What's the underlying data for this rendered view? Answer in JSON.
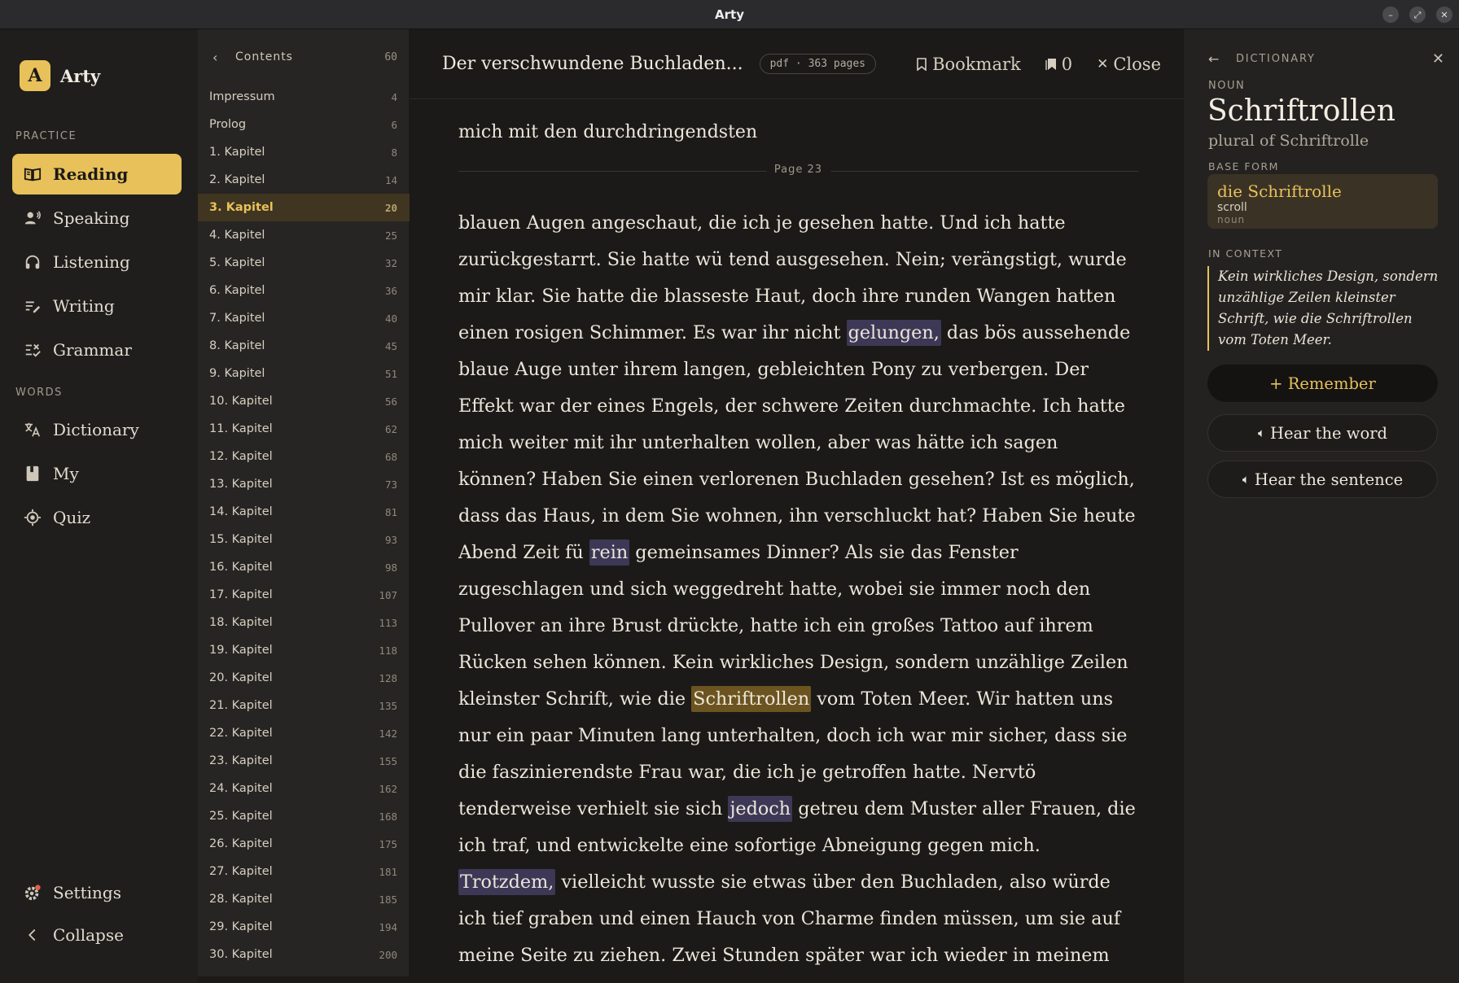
{
  "window": {
    "title": "Arty"
  },
  "brand": {
    "logo_letter": "A",
    "name": "Arty"
  },
  "sidebar": {
    "practice_label": "PRACTICE",
    "words_label": "WORDS",
    "practice_items": [
      {
        "label": "Reading",
        "icon": "book-icon",
        "active": true
      },
      {
        "label": "Speaking",
        "icon": "speaker-person-icon"
      },
      {
        "label": "Listening",
        "icon": "headphones-icon"
      },
      {
        "label": "Writing",
        "icon": "pen-lines-icon"
      },
      {
        "label": "Grammar",
        "icon": "checklist-icon"
      }
    ],
    "words_items": [
      {
        "label": "Dictionary",
        "icon": "translate-icon"
      },
      {
        "label": "My",
        "icon": "notebook-icon"
      },
      {
        "label": "Quiz",
        "icon": "target-icon"
      }
    ],
    "settings_label": "Settings",
    "collapse_label": "Collapse"
  },
  "toc": {
    "title": "Contents",
    "count": "60",
    "items": [
      {
        "title": "Impressum",
        "page": "4"
      },
      {
        "title": "Prolog",
        "page": "6"
      },
      {
        "title": "1. Kapitel",
        "page": "8"
      },
      {
        "title": "2. Kapitel",
        "page": "14"
      },
      {
        "title": "3. Kapitel",
        "page": "20",
        "active": true
      },
      {
        "title": "4. Kapitel",
        "page": "25"
      },
      {
        "title": "5. Kapitel",
        "page": "32"
      },
      {
        "title": "6. Kapitel",
        "page": "36"
      },
      {
        "title": "7. Kapitel",
        "page": "40"
      },
      {
        "title": "8. Kapitel",
        "page": "45"
      },
      {
        "title": "9. Kapitel",
        "page": "51"
      },
      {
        "title": "10. Kapitel",
        "page": "56"
      },
      {
        "title": "11. Kapitel",
        "page": "62"
      },
      {
        "title": "12. Kapitel",
        "page": "68"
      },
      {
        "title": "13. Kapitel",
        "page": "73"
      },
      {
        "title": "14. Kapitel",
        "page": "81"
      },
      {
        "title": "15. Kapitel",
        "page": "93"
      },
      {
        "title": "16. Kapitel",
        "page": "98"
      },
      {
        "title": "17. Kapitel",
        "page": "107"
      },
      {
        "title": "18. Kapitel",
        "page": "113"
      },
      {
        "title": "19. Kapitel",
        "page": "118"
      },
      {
        "title": "20. Kapitel",
        "page": "128"
      },
      {
        "title": "21. Kapitel",
        "page": "135"
      },
      {
        "title": "22. Kapitel",
        "page": "142"
      },
      {
        "title": "23. Kapitel",
        "page": "155"
      },
      {
        "title": "24. Kapitel",
        "page": "162"
      },
      {
        "title": "25. Kapitel",
        "page": "168"
      },
      {
        "title": "26. Kapitel",
        "page": "175"
      },
      {
        "title": "27. Kapitel",
        "page": "181"
      },
      {
        "title": "28. Kapitel",
        "page": "185"
      },
      {
        "title": "29. Kapitel",
        "page": "194"
      },
      {
        "title": "30. Kapitel",
        "page": "200"
      }
    ]
  },
  "reader": {
    "book_title": "Der verschwundene Buchladen...",
    "meta": "pdf · 363 pages",
    "bookmark_label": "Bookmark",
    "bookmark_count": "0",
    "close_label": "Close",
    "prev_line": "mich mit den durchdringendsten",
    "page_label": "Page 23",
    "segments": [
      {
        "t": "blauen Augen angeschaut, die ich je gesehen hatte. Und ich hatte zurückgestarrt. Sie hatte wü tend ausgesehen. Nein; verängstigt, wurde mir klar. Sie hatte die blasseste Haut, doch ihre runden Wangen hatten einen rosigen Schimmer. Es war ihr nicht "
      },
      {
        "t": "gelungen,",
        "hl": "word"
      },
      {
        "t": " das bös aussehende blaue Auge unter ihrem langen, gebleichten Pony zu verbergen. Der Effekt war der eines Engels, der schwere Zeiten durchmachte. Ich hatte mich weiter mit ihr unterhalten wollen, aber was hätte ich sagen können? Haben Sie einen verlorenen Buchladen gesehen? Ist es möglich, dass das Haus, in dem Sie wohnen, ihn verschluckt hat? Haben Sie heute Abend Zeit fü "
      },
      {
        "t": "rein",
        "hl": "word"
      },
      {
        "t": " gemeinsames Dinner? Als sie das Fenster zugeschlagen und sich weggedreht hatte, wobei sie immer noch den Pullover an ihre Brust drückte, hatte ich ein großes Tattoo auf ihrem Rücken sehen können. Kein wirkliches Design, sondern unzählige Zeilen kleinster Schrift, wie die "
      },
      {
        "t": "Schriftrollen",
        "hl": "selected"
      },
      {
        "t": " vom Toten Meer. Wir hatten uns nur ein paar Minuten lang unterhalten, doch ich war mir sicher, dass sie die faszinierendste Frau war, die ich je getroffen hatte. Nervtö tenderweise verhielt sie sich "
      },
      {
        "t": "jedoch",
        "hl": "word"
      },
      {
        "t": " getreu dem Muster aller Frauen, die ich traf, und entwickelte eine sofortige Abneigung gegen mich. "
      },
      {
        "t": "Trotzdem,",
        "hl": "word"
      },
      {
        "t": " vielleicht wusste sie etwas über den Buchladen, also würde ich tief graben und einen Hauch von Charme finden müssen, um sie auf meine Seite zu ziehen. Zwei Stunden später war ich wieder in meinem B&Bund stand"
      }
    ]
  },
  "dictionary": {
    "header": "DICTIONARY",
    "pos": "NOUN",
    "word": "Schriftrollen",
    "subtitle": "plural of Schriftrolle",
    "base_form_label": "BASE FORM",
    "base_word": "die Schriftrolle",
    "base_translation": "scroll",
    "base_pos": "noun",
    "context_label": "IN CONTEXT",
    "context": "Kein wirkliches Design, sondern unzählige Zeilen kleinster Schrift, wie die Schriftrollen vom Toten Meer.",
    "remember_label": "+ Remember",
    "hear_word_label": "Hear the word",
    "hear_sentence_label": "Hear the sentence"
  },
  "colors": {
    "accent": "#e8c15a",
    "background": "#1b1a18",
    "highlight": "#3d3856",
    "selected_highlight": "#6b5420"
  }
}
